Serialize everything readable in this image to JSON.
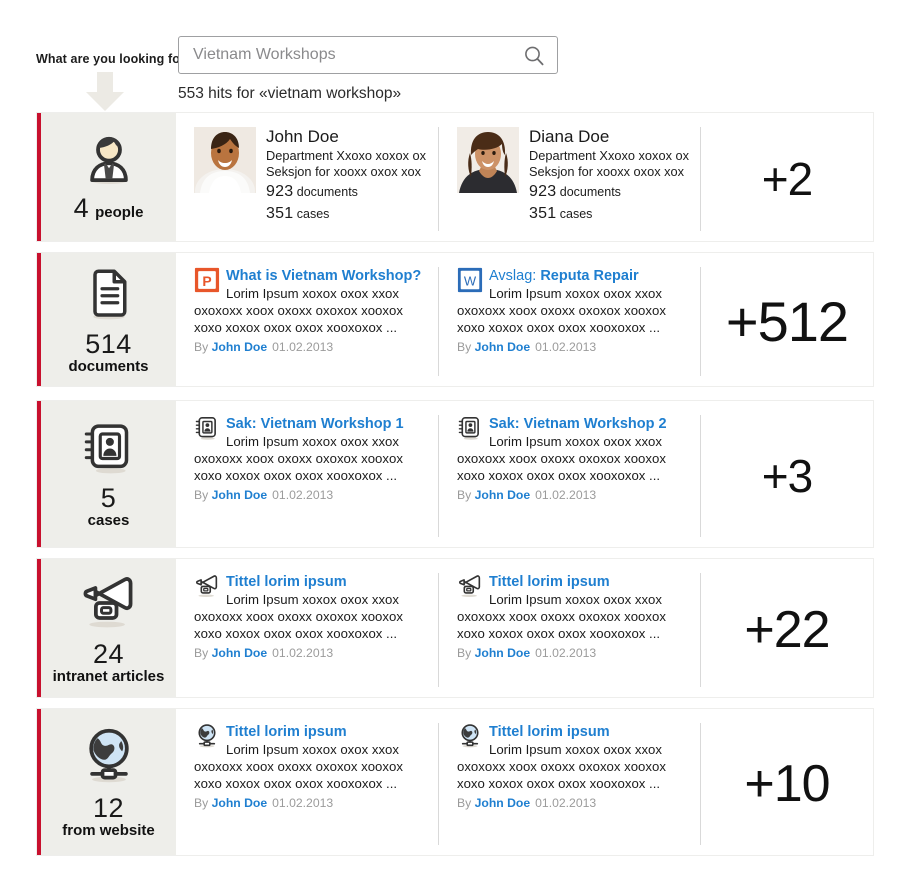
{
  "search": {
    "label": "What are you looking for?",
    "value": "Vietnam Workshops",
    "placeholder": "Vietnam Workshops",
    "icon": "search-icon",
    "arrow_icon": "arrow-down-icon",
    "hits_text": "553 hits for «vietnam workshop»"
  },
  "accent_color": "#c8102e",
  "link_color": "#1f7fd0",
  "panel_bg": "#eeeeea",
  "rows": [
    {
      "id": "people",
      "icon": "person-icon",
      "count": "4",
      "label": "people",
      "layout": "inline",
      "more": "+2",
      "items": [
        {
          "type": "person",
          "name": "John Doe",
          "department": "Department Xxoxo xoxox ox",
          "section": "Seksjon for xooxx oxox xox",
          "documents_count": "923",
          "documents_label": "documents",
          "cases_count": "351",
          "cases_label": "cases",
          "photo": "photo-john-doe"
        },
        {
          "type": "person",
          "name": "Diana Doe",
          "department": "Department Xxoxo xoxox ox",
          "section": "Seksjon for xooxx oxox xox",
          "documents_count": "923",
          "documents_label": "documents",
          "cases_count": "351",
          "cases_label": "cases",
          "photo": "photo-diana-doe"
        }
      ]
    },
    {
      "id": "documents",
      "icon": "document-icon",
      "count": "514",
      "label": "documents",
      "layout": "stack",
      "more": "+512",
      "items": [
        {
          "type": "doc",
          "icon": "powerpoint-icon",
          "title_prefix": "",
          "title": "What is Vietnam Workshop?",
          "snippet": "Lorim Ipsum xoxox oxox xxox oxoxoxx xoox oxoxx oxoxox xooxox xoxo xoxox oxox oxox xooxoxox ...",
          "by_label": "By",
          "author": "John Doe",
          "date": "01.02.2013"
        },
        {
          "type": "doc",
          "icon": "word-icon",
          "title_prefix": "Avslag: ",
          "title": "Reputa Repair",
          "snippet": "Lorim Ipsum xoxox oxox xxox oxoxoxx xoox oxoxx oxoxox xooxox xoxo xoxox oxox oxox xooxoxox ...",
          "by_label": "By",
          "author": "John Doe",
          "date": "01.02.2013"
        }
      ]
    },
    {
      "id": "cases",
      "icon": "case-book-icon",
      "count": "5",
      "label": "cases",
      "layout": "stack",
      "more": "+3",
      "items": [
        {
          "type": "doc",
          "icon": "case-book-icon",
          "title_prefix": "",
          "title": "Sak: Vietnam Workshop 1",
          "snippet": "Lorim Ipsum xoxox oxox xxox oxoxoxx xoox oxoxx oxoxox xooxox xoxo xoxox oxox oxox xooxoxox  ...",
          "by_label": "By",
          "author": "John Doe",
          "date": "01.02.2013"
        },
        {
          "type": "doc",
          "icon": "case-book-icon",
          "title_prefix": "",
          "title": "Sak: Vietnam Workshop 2",
          "snippet": "Lorim Ipsum xoxox oxox xxox oxoxoxx xoox oxoxx oxoxox xooxox xoxo xoxox oxox oxox xooxoxox  ...",
          "by_label": "By",
          "author": "John Doe",
          "date": "01.02.2013"
        }
      ]
    },
    {
      "id": "intranet",
      "icon": "megaphone-icon",
      "count": "24",
      "label": "intranet articles",
      "layout": "stack",
      "more": "+22",
      "items": [
        {
          "type": "doc",
          "icon": "megaphone-icon",
          "title_prefix": "",
          "title": "Tittel lorim ipsum",
          "snippet": "Lorim Ipsum xoxox oxox xxox oxoxoxx xoox oxoxx oxoxox xooxox xoxo xoxox oxox oxox xooxoxox  ...",
          "by_label": "By",
          "author": "John Doe",
          "date": "01.02.2013"
        },
        {
          "type": "doc",
          "icon": "megaphone-icon",
          "title_prefix": "",
          "title": "Tittel lorim ipsum",
          "snippet": "Lorim Ipsum xoxox oxox xxox oxoxoxx xoox oxoxx oxoxox xooxox xoxo xoxox oxox oxox xooxoxox  ...",
          "by_label": "By",
          "author": "John Doe",
          "date": "01.02.2013"
        }
      ]
    },
    {
      "id": "website",
      "icon": "globe-icon",
      "count": "12",
      "label": "from website",
      "layout": "stack",
      "more": "+10",
      "items": [
        {
          "type": "doc",
          "icon": "globe-icon",
          "title_prefix": "",
          "title": "Tittel lorim ipsum",
          "snippet": "Lorim Ipsum xoxox oxox xxox oxoxoxx xoox oxoxx oxoxox xooxox xoxo xoxox oxox oxox xooxoxox  ...",
          "by_label": "By",
          "author": "John Doe",
          "date": "01.02.2013"
        },
        {
          "type": "doc",
          "icon": "globe-icon",
          "title_prefix": "",
          "title": "Tittel lorim ipsum",
          "snippet": "Lorim Ipsum xoxox oxox xxox oxoxoxx xoox oxoxx oxoxox xooxox xoxo xoxox oxox oxox xooxoxox  ...",
          "by_label": "By",
          "author": "John Doe",
          "date": "01.02.2013"
        }
      ]
    }
  ]
}
